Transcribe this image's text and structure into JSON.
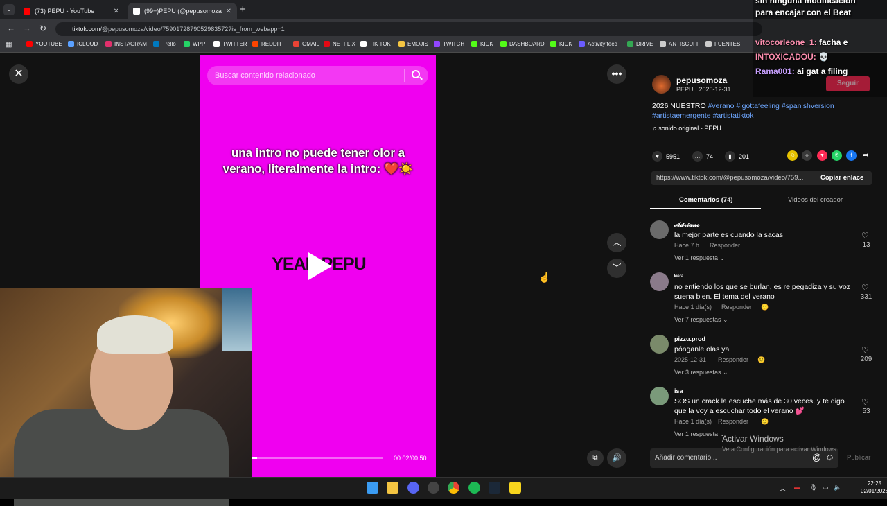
{
  "browser": {
    "tabs": [
      {
        "title": "(73) PEPU - YouTube",
        "favicon_color": "#ff0000"
      },
      {
        "title": "(99+)PEPU (@pepusomoza",
        "favicon_color": "#ffffff"
      }
    ],
    "url_host": "tiktok.com",
    "url_path": "/@pepusomoza/video/7590172879052983572?is_from_webapp=1",
    "bookmarks": [
      {
        "label": "YOUTUBE",
        "color": "#ff0000"
      },
      {
        "label": "ICLOUD",
        "color": "#5aa0ff"
      },
      {
        "label": "INSTAGRAM",
        "color": "#e1306c"
      },
      {
        "label": "Trello",
        "color": "#0079bf"
      },
      {
        "label": "WPP",
        "color": "#25d366"
      },
      {
        "label": "TWITTER",
        "color": "#ffffff"
      },
      {
        "label": "REDDIT",
        "color": "#ff4500"
      },
      {
        "label": "GMAIL",
        "color": "#ea4335"
      },
      {
        "label": "NETFLIX",
        "color": "#e50914"
      },
      {
        "label": "TIK TOK",
        "color": "#ffffff"
      },
      {
        "label": "EMOJIS",
        "color": "#f4c542"
      },
      {
        "label": "TWITCH",
        "color": "#9146ff"
      },
      {
        "label": "KICK",
        "color": "#53fc18"
      },
      {
        "label": "DASHBOARD",
        "color": "#53fc18"
      },
      {
        "label": "KICK",
        "color": "#53fc18"
      },
      {
        "label": "Activity feed",
        "color": "#6b5cff"
      },
      {
        "label": "DRIVE",
        "color": "#34a853"
      },
      {
        "label": "ANTISCUFF",
        "color": "#cccccc"
      },
      {
        "label": "FUENTES",
        "color": "#cccccc"
      }
    ]
  },
  "video": {
    "search_placeholder": "Buscar contenido relacionado",
    "caption": "una intro no puede tener olor a verano, literalmente la intro: ❤️☀️",
    "overlay_text": "YEAH PEPU",
    "timecode": "00:02/00:50",
    "progress_fraction": 0.04,
    "background_color": "#f000f0"
  },
  "creator": {
    "username": "pepusomoza",
    "subtitle": "PEPU · 2025-12-31",
    "follow_label": "Seguir",
    "description_text": "2026 NUESTRO",
    "hashtags": [
      "#verano",
      "#igottafeeling",
      "#spanishversion",
      "#artistaemergente",
      "#artistatiktok"
    ],
    "music": "sonido original - PEPU"
  },
  "stats": {
    "likes": "5951",
    "comments": "74",
    "saves": "201"
  },
  "link": {
    "url": "https://www.tiktok.com/@pepusomoza/video/759...",
    "copy_label": "Copiar enlace"
  },
  "tabs": {
    "comments": "Comentarios (74)",
    "creator_videos": "Videos del creador"
  },
  "comments": [
    {
      "name": "𝓐𝓭𝓻𝓲𝓪𝓷𝓸",
      "text": "la mejor parte es cuando la sacas",
      "time": "Hace 7 h",
      "reply": "Responder",
      "likes": "13",
      "more": "Ver 1 respuesta ⌄",
      "avatar_color": "#6b6b6b"
    },
    {
      "name": "ᵏᶦᵉʳᵃ",
      "text": "no entiendo los que se burlan, es re pegadiza y su voz suena bien. El tema del verano",
      "time": "Hace 1 día(s)",
      "reply": "Responder",
      "likes": "331",
      "more": "Ver 7 respuestas ⌄",
      "avatar_color": "#8a7a8a"
    },
    {
      "name": "pizzu.prod",
      "text": "pónganle olas ya",
      "time": "2025-12-31",
      "reply": "Responder",
      "likes": "209",
      "more": "Ver 3 respuestas ⌄",
      "avatar_color": "#7a8a6a"
    },
    {
      "name": "isa",
      "text": "SOS un crack la escuche más de 30 veces, y te digo que la voy a escuchar todo el verano 💕",
      "time": "Hace 1 día(s)",
      "reply": "Responder",
      "likes": "53",
      "more": "Ver 1 respuesta ⌄",
      "avatar_color": "#7a9a7a"
    }
  ],
  "comment_input": {
    "placeholder": "Añadir comentario...",
    "publish": "Publicar"
  },
  "windows_watermark": {
    "line1": "Activar Windows",
    "line2": "Ve a Configuración para activar Windows."
  },
  "chat_overlay": [
    {
      "user": "",
      "text": "sin ninguna modificación"
    },
    {
      "user": "",
      "text": "para encajar con el Beat"
    },
    {
      "user": "vitocorleone_1:",
      "text": "facha e"
    },
    {
      "user": "INTOXICADOU:",
      "text": "💀"
    },
    {
      "user": "Rama001:",
      "text": "ai gat a filing"
    }
  ],
  "taskbar": {
    "time": "22:25",
    "date": "02/01/2026"
  }
}
